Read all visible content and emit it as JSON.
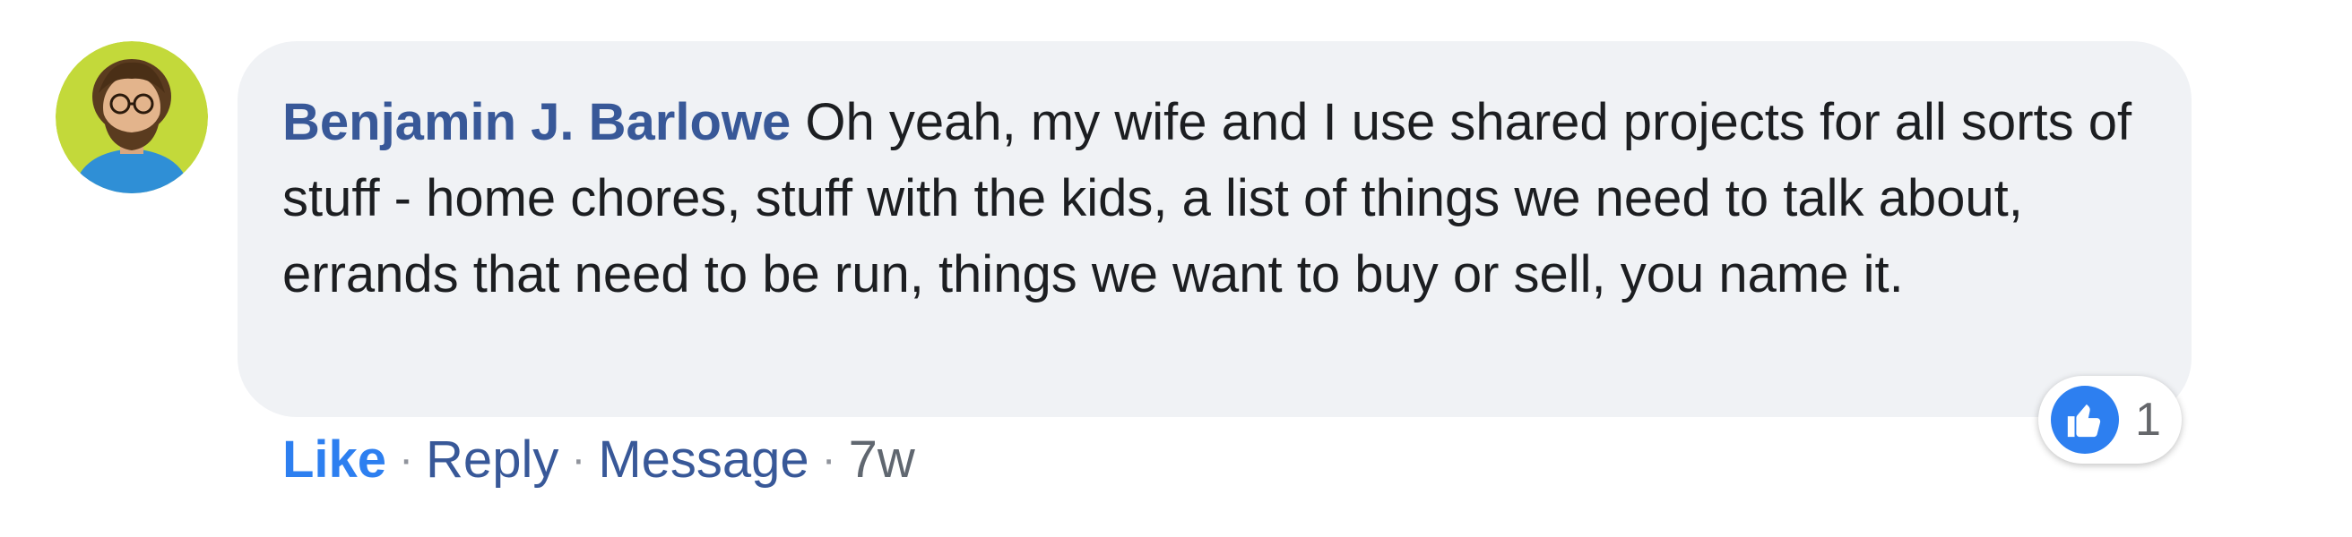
{
  "comment": {
    "author": "Benjamin J. Barlowe",
    "text": "Oh yeah, my wife and I use shared projects for all sorts of stuff - home chores, stuff with the kids, a list of things we need to talk about, errands that need to be run, things we want to buy or sell, you name it."
  },
  "reactions": {
    "type": "like-icon",
    "count": "1"
  },
  "actions": {
    "like": "Like",
    "reply": "Reply",
    "message": "Message",
    "separator": "·",
    "time": "7w"
  },
  "colors": {
    "author_link": "#385898",
    "like_blue": "#2d7ff0",
    "bubble_bg": "#f0f2f5",
    "avatar_bg": "#c3d93a"
  }
}
